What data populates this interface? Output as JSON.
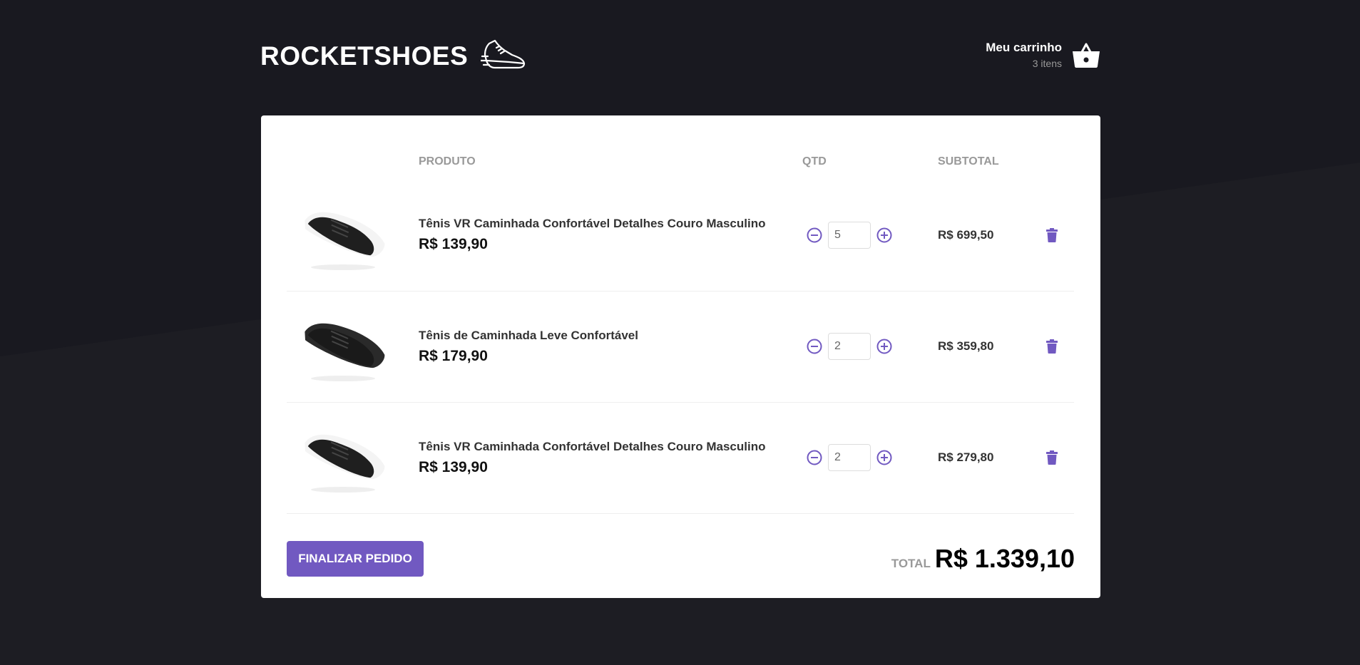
{
  "brand": {
    "name": "ROCKETSHOES"
  },
  "cart": {
    "title": "Meu carrinho",
    "count": "3 itens"
  },
  "table": {
    "headers": {
      "product": "PRODUTO",
      "qty": "QTD",
      "subtotal": "SUBTOTAL"
    },
    "rows": [
      {
        "name": "Tênis VR Caminhada Confortável Detalhes Couro Masculino",
        "price": "R$ 139,90",
        "qty": "5",
        "subtotal": "R$ 699,50",
        "shoe_color": "#1f1f1f",
        "sole_color": "#f4f4f4"
      },
      {
        "name": "Tênis de Caminhada Leve Confortável",
        "price": "R$ 179,90",
        "qty": "2",
        "subtotal": "R$ 359,80",
        "shoe_color": "#1a1a1a",
        "sole_color": "#2a2a2a"
      },
      {
        "name": "Tênis VR Caminhada Confortável Detalhes Couro Masculino",
        "price": "R$ 139,90",
        "qty": "2",
        "subtotal": "R$ 279,80",
        "shoe_color": "#1f1f1f",
        "sole_color": "#f4f4f4"
      }
    ]
  },
  "footer": {
    "button_label": "FINALIZAR PEDIDO",
    "total_label": "TOTAL",
    "total_value": "R$ 1.339,10"
  },
  "colors": {
    "accent": "#7159c1",
    "background": "#191920"
  },
  "icons": {
    "logo": "sneaker-icon",
    "cart": "basket-icon",
    "decrease": "minus-circle-icon",
    "increase": "plus-circle-icon",
    "delete": "trash-icon"
  }
}
